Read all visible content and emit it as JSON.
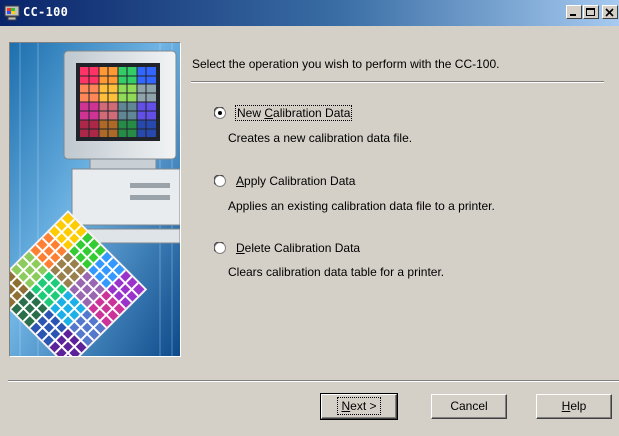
{
  "window": {
    "title": "CC-100"
  },
  "prompt": "Select the operation you wish to perform with the CC-100.",
  "options": [
    {
      "label_pre": "New ",
      "label_key": "C",
      "label_post": "alibration Data",
      "description": "Creates a new calibration data file.",
      "selected": true
    },
    {
      "label_pre": "",
      "label_key": "A",
      "label_post": "pply Calibration Data",
      "description": "Applies an existing calibration data file to a printer.",
      "selected": false
    },
    {
      "label_pre": "",
      "label_key": "D",
      "label_post": "elete Calibration Data",
      "description": "Clears calibration data table for a printer.",
      "selected": false
    }
  ],
  "buttons": {
    "next": {
      "key": "N",
      "rest": "ext >"
    },
    "cancel": {
      "label": "Cancel"
    },
    "help": {
      "key": "H",
      "rest": "elp"
    }
  },
  "icons": [
    "app-icon",
    "minimize-icon",
    "maximize-icon",
    "close-icon"
  ],
  "colors": {
    "face": "#d4d0c8",
    "title_start": "#0a246a",
    "title_end": "#a6caf0"
  }
}
